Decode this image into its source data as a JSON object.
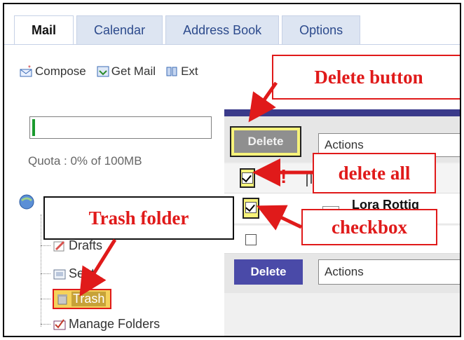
{
  "tabs": [
    "Mail",
    "Calendar",
    "Address Book",
    "Options"
  ],
  "toolbar": {
    "compose": "Compose",
    "get_mail": "Get Mail",
    "external": "Ext"
  },
  "quota": {
    "text": "Quota : 0% of 100MB",
    "percent": 0
  },
  "folders": {
    "drafts": "Drafts",
    "sent": "Sent",
    "trash": "Trash",
    "manage": "Manage Folders"
  },
  "list": {
    "delete_label": "Delete",
    "actions_label": "Actions",
    "row_sender": "Lora Rottig"
  },
  "callouts": {
    "delete_button": "Delete button",
    "delete_all": "delete all",
    "trash_folder": "Trash folder",
    "checkbox": "checkbox"
  },
  "colors": {
    "annotation_red": "#e01a1a",
    "highlight": "#f7f37a",
    "button_blue": "#4a4aa8"
  }
}
